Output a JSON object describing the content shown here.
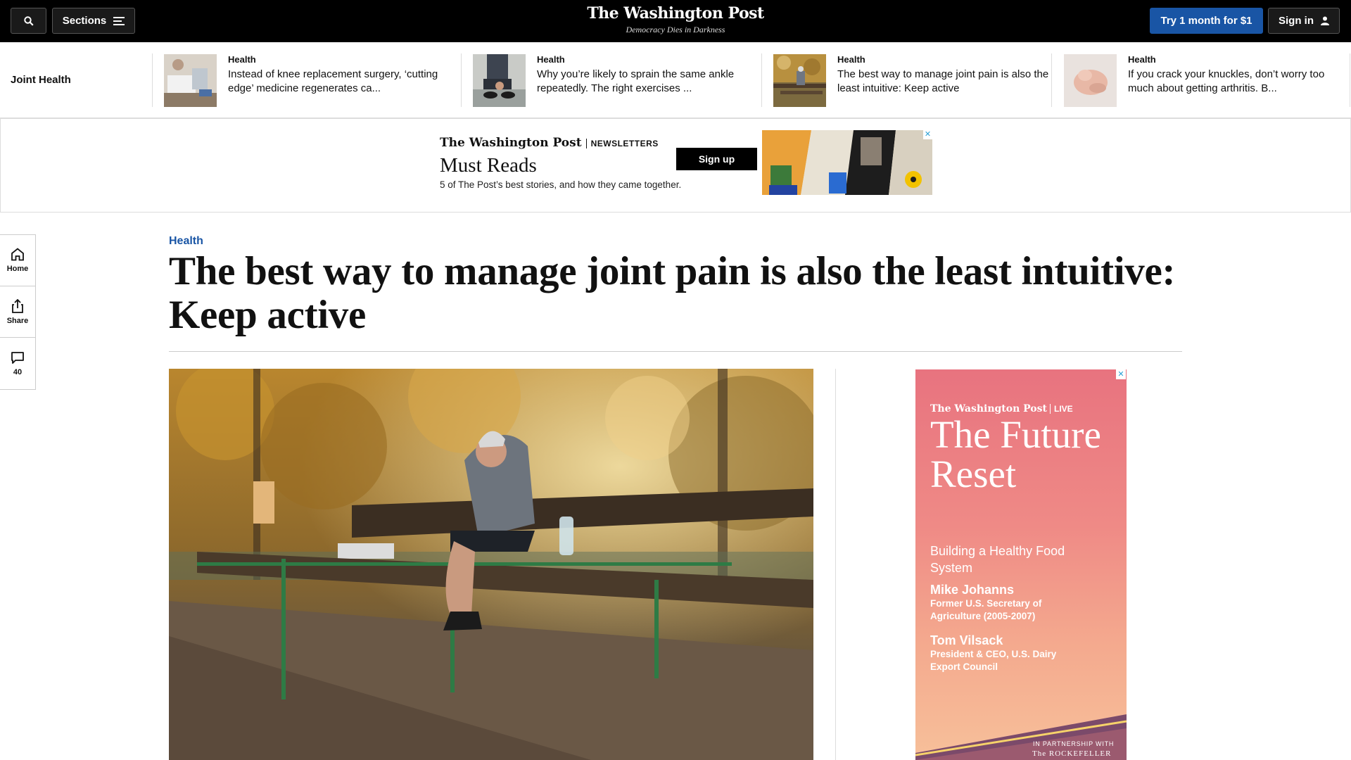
{
  "topbar": {
    "sections_label": "Sections",
    "logo_text": "The Washington Post",
    "tagline": "Democracy Dies in Darkness",
    "subscribe_label": "Try 1 month for $1",
    "signin_label": "Sign in"
  },
  "topic_strip": {
    "label": "Joint Health",
    "items": [
      {
        "kicker": "Health",
        "headline": "Instead of knee replacement surgery, ‘cutting edge’ medicine regenerates ca..."
      },
      {
        "kicker": "Health",
        "headline": "Why you’re likely to sprain the same ankle repeatedly. The right exercises ..."
      },
      {
        "kicker": "Health",
        "headline": "The best way to manage joint pain is also the least intuitive: Keep active"
      },
      {
        "kicker": "Health",
        "headline": "If you crack your knuckles, don’t worry too much about getting arthritis. B..."
      }
    ]
  },
  "banner_ad": {
    "brand": "The Washington Post",
    "brand_section": "NEWSLETTERS",
    "title": "Must Reads",
    "subtitle": "5 of The Post’s best stories, and how they came together.",
    "cta": "Sign up"
  },
  "left_rail": {
    "home_label": "Home",
    "share_label": "Share",
    "comments_count": "40"
  },
  "article": {
    "kicker": "Health",
    "headline": "The best way to manage joint pain is also the least intuitive: Keep active"
  },
  "side_ad": {
    "brand": "The Washington Post",
    "brand_section": "LIVE",
    "title": "The Future Reset",
    "subtitle": "Building a Healthy Food System",
    "person1_name": "Mike Johanns",
    "person1_role": "Former U.S. Secretary of Agriculture (2005-2007)",
    "person2_name": "Tom Vilsack",
    "person2_role": "President & CEO, U.S. Dairy Export Council",
    "partner_label": "IN PARTNERSHIP WITH",
    "partner_name": "The ROCKEFELLER"
  },
  "colors": {
    "topbar_bg": "#000000",
    "accent_blue": "#1955a5",
    "kicker_blue": "#1955a5"
  }
}
